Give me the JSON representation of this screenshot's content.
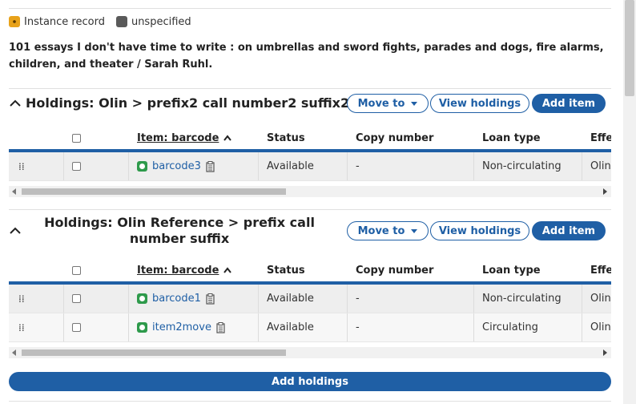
{
  "record": {
    "instance_label": "Instance record",
    "unspecified_label": "unspecified",
    "title": "101 essays I don't have time to write : on umbrellas and sword fights, parades and dogs, fire alarms, children, and theater / Sarah Ruhl."
  },
  "holdings": [
    {
      "title": "Holdings: Olin > prefix2 call number2 suffix2",
      "move_to": "Move to",
      "view": "View holdings",
      "add_item": "Add item",
      "columns": [
        "Item: barcode",
        "Status",
        "Copy number",
        "Loan type",
        "Effe"
      ],
      "rows": [
        {
          "barcode": "barcode3",
          "status": "Available",
          "copy": "-",
          "loan": "Non-circulating",
          "eff": "Olin"
        }
      ]
    },
    {
      "title_line1": "Holdings: Olin Reference > prefix call",
      "title_line2": "number suffix",
      "move_to": "Move to",
      "view": "View holdings",
      "add_item": "Add item",
      "columns": [
        "Item: barcode",
        "Status",
        "Copy number",
        "Loan type",
        "Effe"
      ],
      "rows": [
        {
          "barcode": "barcode1",
          "status": "Available",
          "copy": "-",
          "loan": "Non-circulating",
          "eff": "Olin"
        },
        {
          "barcode": "item2move",
          "status": "Available",
          "copy": "-",
          "loan": "Circulating",
          "eff": "Olin"
        }
      ]
    }
  ],
  "add_holdings": "Add holdings",
  "colors": {
    "accent": "#1f5fa5",
    "status_green": "#2e9a4b",
    "instance_badge": "#e8a21a"
  }
}
